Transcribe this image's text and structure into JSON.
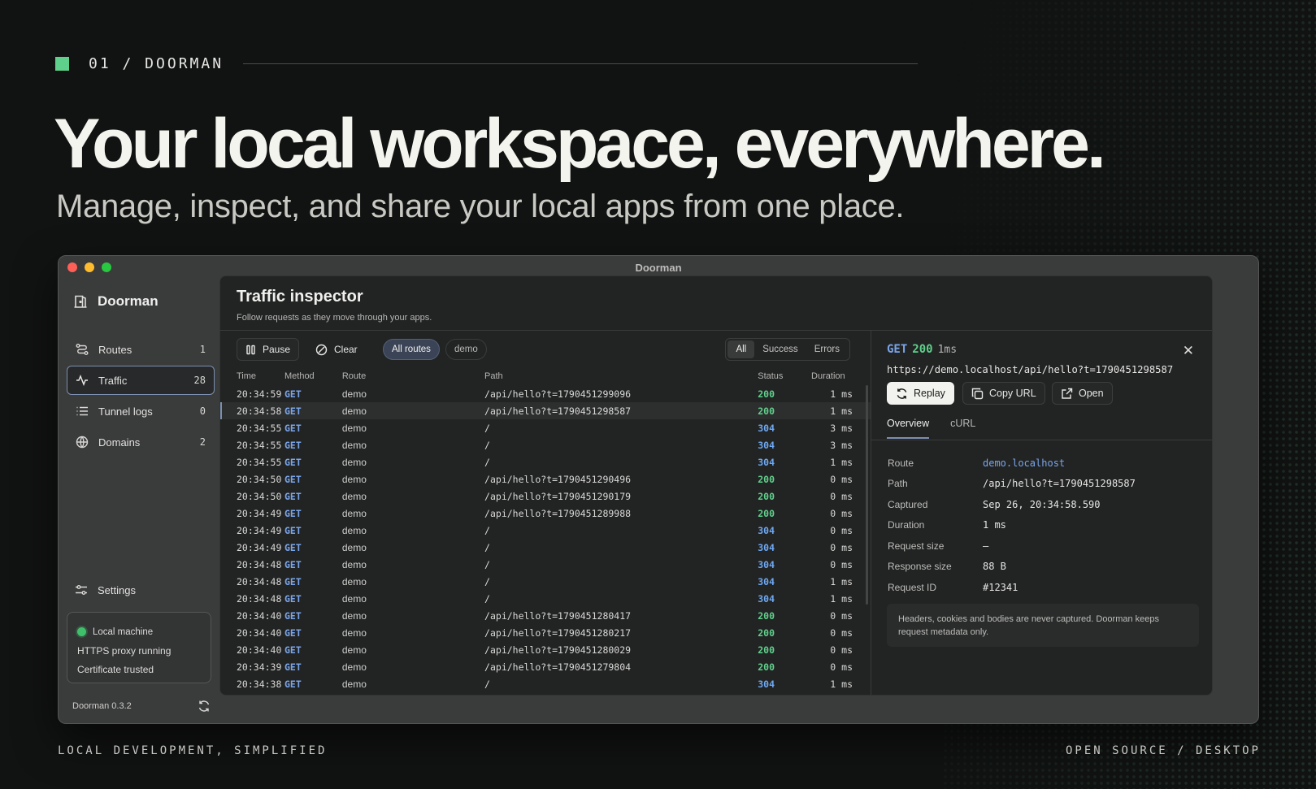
{
  "hero": {
    "eyebrow": "01 / DOORMAN",
    "headline": "Your local workspace, everywhere.",
    "subhead": "Manage, inspect, and share your local apps from one place.",
    "footer_left": "LOCAL DEVELOPMENT, SIMPLIFIED",
    "footer_right": "OPEN SOURCE / DESKTOP",
    "accent_color": "#5fd08b"
  },
  "window": {
    "title": "Doorman"
  },
  "sidebar": {
    "brand": "Doorman",
    "items": [
      {
        "label": "Routes",
        "count": "1",
        "icon": "routes-icon"
      },
      {
        "label": "Traffic",
        "count": "28",
        "icon": "activity-icon",
        "active": true
      },
      {
        "label": "Tunnel logs",
        "count": "0",
        "icon": "list-icon"
      },
      {
        "label": "Domains",
        "count": "2",
        "icon": "globe-icon"
      }
    ],
    "settings": "Settings",
    "status": [
      "Local machine",
      "HTTPS proxy running",
      "Certificate trusted"
    ],
    "version": "Doorman 0.3.2"
  },
  "main": {
    "title": "Traffic inspector",
    "subtitle": "Follow requests as they move through your apps.",
    "toolbar": {
      "pause": "Pause",
      "clear": "Clear",
      "route_filters": [
        "All routes",
        "demo"
      ],
      "status_filters": [
        "All",
        "Success",
        "Errors"
      ]
    },
    "columns": [
      "Time",
      "Method",
      "Route",
      "Path",
      "Status",
      "Duration"
    ],
    "rows": [
      [
        "20:34:59",
        "GET",
        "demo",
        "/api/hello?t=1790451299096",
        "200",
        "1 ms"
      ],
      [
        "20:34:58",
        "GET",
        "demo",
        "/api/hello?t=1790451298587",
        "200",
        "1 ms"
      ],
      [
        "20:34:55",
        "GET",
        "demo",
        "/",
        "304",
        "3 ms"
      ],
      [
        "20:34:55",
        "GET",
        "demo",
        "/",
        "304",
        "3 ms"
      ],
      [
        "20:34:55",
        "GET",
        "demo",
        "/",
        "304",
        "1 ms"
      ],
      [
        "20:34:50",
        "GET",
        "demo",
        "/api/hello?t=1790451290496",
        "200",
        "0 ms"
      ],
      [
        "20:34:50",
        "GET",
        "demo",
        "/api/hello?t=1790451290179",
        "200",
        "0 ms"
      ],
      [
        "20:34:49",
        "GET",
        "demo",
        "/api/hello?t=1790451289988",
        "200",
        "0 ms"
      ],
      [
        "20:34:49",
        "GET",
        "demo",
        "/",
        "304",
        "0 ms"
      ],
      [
        "20:34:49",
        "GET",
        "demo",
        "/",
        "304",
        "0 ms"
      ],
      [
        "20:34:48",
        "GET",
        "demo",
        "/",
        "304",
        "0 ms"
      ],
      [
        "20:34:48",
        "GET",
        "demo",
        "/",
        "304",
        "1 ms"
      ],
      [
        "20:34:48",
        "GET",
        "demo",
        "/",
        "304",
        "1 ms"
      ],
      [
        "20:34:40",
        "GET",
        "demo",
        "/api/hello?t=1790451280417",
        "200",
        "0 ms"
      ],
      [
        "20:34:40",
        "GET",
        "demo",
        "/api/hello?t=1790451280217",
        "200",
        "0 ms"
      ],
      [
        "20:34:40",
        "GET",
        "demo",
        "/api/hello?t=1790451280029",
        "200",
        "0 ms"
      ],
      [
        "20:34:39",
        "GET",
        "demo",
        "/api/hello?t=1790451279804",
        "200",
        "0 ms"
      ],
      [
        "20:34:38",
        "GET",
        "demo",
        "/",
        "304",
        "1 ms"
      ]
    ],
    "selected_row": 1
  },
  "detail": {
    "method": "GET",
    "status": "200",
    "duration": "1ms",
    "url": "https://demo.localhost/api/hello?t=1790451298587",
    "buttons": {
      "replay": "Replay",
      "copy": "Copy URL",
      "open": "Open"
    },
    "tabs": [
      "Overview",
      "cURL"
    ],
    "fields": [
      {
        "k": "Route",
        "v": "demo.localhost"
      },
      {
        "k": "Path",
        "v": "/api/hello?t=1790451298587"
      },
      {
        "k": "Captured",
        "v": "Sep 26, 20:34:58.590"
      },
      {
        "k": "Duration",
        "v": "1 ms"
      },
      {
        "k": "Request size",
        "v": "–"
      },
      {
        "k": "Response size",
        "v": "88 B"
      },
      {
        "k": "Request ID",
        "v": "#12341"
      }
    ],
    "note": "Headers, cookies and bodies are never captured. Doorman keeps request metadata only."
  }
}
